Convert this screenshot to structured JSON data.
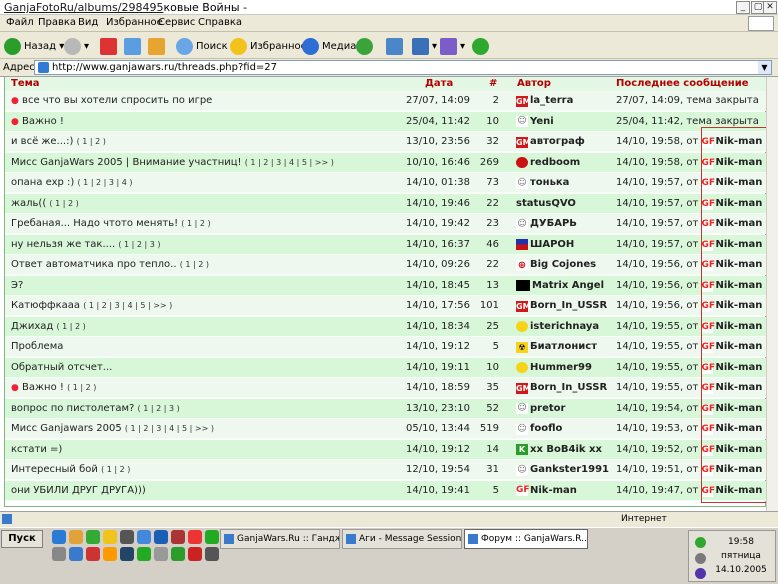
{
  "window": {
    "title_prefix": "GanjaFotoRu/albums/298495",
    "title_rest": "ковые Войны -"
  },
  "menu": [
    "Файл",
    "Правка",
    "Вид",
    "Избранное",
    "Сервис",
    "Справка"
  ],
  "toolbar": {
    "back": "Назад",
    "search": "Поиск",
    "favorites": "Избранное",
    "media": "Медиа"
  },
  "address": {
    "label": "Адрес:",
    "value": "http://www.ganjawars.ru/threads.php?fid=27"
  },
  "table": {
    "headers": {
      "topic": "Тема",
      "date": "Дата",
      "count": "#",
      "author": "Автор",
      "last": "Последнее сообщение"
    },
    "rows": [
      {
        "icon": "●",
        "title": "все что вы хотели спросить по игре",
        "pages": "",
        "date": "27/07, 14:09",
        "count": "2",
        "author": "la_terra",
        "author_icon": "gm",
        "last": "27/07, 14:09, тема закрыта",
        "last_name": ""
      },
      {
        "icon": "●",
        "title": "Важно !",
        "pages": "",
        "date": "25/04, 11:42",
        "count": "10",
        "author": "Yeni",
        "author_icon": "man",
        "last": "25/04, 11:42, тема закрыта",
        "last_name": ""
      },
      {
        "icon": "",
        "title": "и всё же...:)",
        "pages": "( 1 | 2 )",
        "date": "13/10, 23:56",
        "count": "32",
        "author": "автограф",
        "author_icon": "gm",
        "last": "14/10, 19:58, от ",
        "last_name": "Nik-man"
      },
      {
        "icon": "",
        "title": "Мисс GanjaWars 2005 | Внимание участниц!",
        "pages": "( 1 | 2 | 3 | 4 | 5 | >> )",
        "date": "10/10, 16:46",
        "count": "269",
        "author": "redboom",
        "author_icon": "bomb",
        "last": "14/10, 19:58, от ",
        "last_name": "Nik-man"
      },
      {
        "icon": "",
        "title": "опана exp :)",
        "pages": "( 1 | 2 | 3 | 4 )",
        "date": "14/10, 01:38",
        "count": "73",
        "author": "тонька",
        "author_icon": "man",
        "last": "14/10, 19:57, от ",
        "last_name": "Nik-man"
      },
      {
        "icon": "",
        "title": "жаль((",
        "pages": "( 1 | 2 )",
        "date": "14/10, 19:46",
        "count": "22",
        "author": "statusQVO",
        "author_icon": "",
        "last": "14/10, 19:57, от ",
        "last_name": "Nik-man"
      },
      {
        "icon": "",
        "title": "Гребаная... Надо чтото менять!",
        "pages": "( 1 | 2 )",
        "date": "14/10, 19:42",
        "count": "23",
        "author": "ДУБАРЬ",
        "author_icon": "man",
        "last": "14/10, 19:57, от ",
        "last_name": "Nik-man"
      },
      {
        "icon": "",
        "title": "ну нельзя же так....",
        "pages": "( 1 | 2 | 3 )",
        "date": "14/10, 16:37",
        "count": "46",
        "author": "ШАРОН",
        "author_icon": "flag",
        "last": "14/10, 19:57, от ",
        "last_name": "Nik-man"
      },
      {
        "icon": "",
        "title": "Ответ автоматчика про тепло..",
        "pages": "( 1 | 2 )",
        "date": "14/10, 09:26",
        "count": "22",
        "author": "Big Cojones",
        "author_icon": "plus",
        "last": "14/10, 19:56, от ",
        "last_name": "Nik-man"
      },
      {
        "icon": "",
        "title": "Э?",
        "pages": "",
        "date": "14/10, 18:45",
        "count": "13",
        "author": "Matrix Angel",
        "author_icon": "black",
        "last": "14/10, 19:56, от ",
        "last_name": "Nik-man"
      },
      {
        "icon": "",
        "title": "Катюффкааа",
        "pages": "( 1 | 2 | 3 | 4 | 5 | >> )",
        "date": "14/10, 17:56",
        "count": "101",
        "author": "Born_In_USSR",
        "author_icon": "gm",
        "last": "14/10, 19:56, от ",
        "last_name": "Nik-man"
      },
      {
        "icon": "",
        "title": "Джихад",
        "pages": "( 1 | 2 )",
        "date": "14/10, 18:34",
        "count": "25",
        "author": "isterichnaya",
        "author_icon": "smile",
        "last": "14/10, 19:55, от ",
        "last_name": "Nik-man"
      },
      {
        "icon": "",
        "title": "Проблема",
        "pages": "",
        "date": "14/10, 19:12",
        "count": "5",
        "author": "Биатлонист",
        "author_icon": "bio",
        "last": "14/10, 19:55, от ",
        "last_name": "Nik-man"
      },
      {
        "icon": "",
        "title": "Обратный отсчет...",
        "pages": "",
        "date": "14/10, 19:11",
        "count": "10",
        "author": "Hummer99",
        "author_icon": "smile",
        "last": "14/10, 19:55, от ",
        "last_name": "Nik-man"
      },
      {
        "icon": "●",
        "title": "Важно !",
        "pages": "( 1 | 2 )",
        "date": "14/10, 18:59",
        "count": "35",
        "author": "Born_In_USSR",
        "author_icon": "gm",
        "last": "14/10, 19:55, от ",
        "last_name": "Nik-man"
      },
      {
        "icon": "",
        "title": "вопрос по пистолетам?",
        "pages": "( 1 | 2 | 3 )",
        "date": "13/10, 23:10",
        "count": "52",
        "author": "pretor",
        "author_icon": "man",
        "last": "14/10, 19:54, от ",
        "last_name": "Nik-man"
      },
      {
        "icon": "",
        "title": "Мисс Ganjawars 2005",
        "pages": "( 1 | 2 | 3 | 4 | 5 | >> )",
        "date": "05/10, 13:44",
        "count": "519",
        "author": "fooflo",
        "author_icon": "man",
        "last": "14/10, 19:53, от ",
        "last_name": "Nik-man"
      },
      {
        "icon": "",
        "title": "кстати =)",
        "pages": "",
        "date": "14/10, 19:12",
        "count": "14",
        "author": "xx BoB4ik xx",
        "author_icon": "k",
        "last": "14/10, 19:52, от ",
        "last_name": "Nik-man"
      },
      {
        "icon": "",
        "title": "Интересный бой",
        "pages": "( 1 | 2 )",
        "date": "12/10, 19:54",
        "count": "31",
        "author": "Gankster1991",
        "author_icon": "man",
        "last": "14/10, 19:51, от ",
        "last_name": "Nik-man"
      },
      {
        "icon": "",
        "title": "они УБИЛИ ДРУГ ДРУГА)))",
        "pages": "",
        "date": "14/10, 19:41",
        "count": "5",
        "author": "Nik-man",
        "author_icon": "gf",
        "last": "14/10, 19:47, от ",
        "last_name": "Nik-man"
      }
    ]
  },
  "status": {
    "zone": "Интернет"
  },
  "taskbar": {
    "start": "Пуск",
    "tasks": [
      "GanjaWars.Ru :: Гандж...",
      "Аги - Message Session (...",
      "Форум :: GanjaWars.R..."
    ],
    "time": "19:58",
    "day": "пятница",
    "date": "14.10.2005"
  }
}
